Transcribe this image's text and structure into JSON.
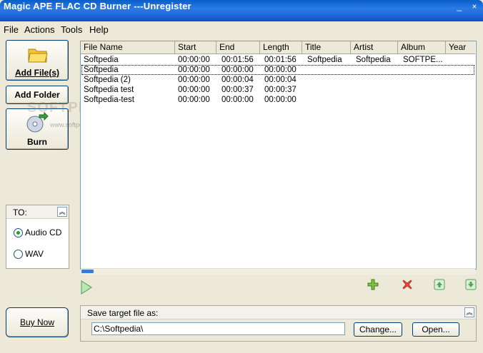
{
  "window": {
    "title": "Magic APE FLAC CD Burner ---Unregister",
    "minimize": "_",
    "close": "×"
  },
  "menu": [
    "File",
    "Actions",
    "Tools",
    "Help"
  ],
  "left": {
    "add_files": "Add File(s)",
    "add_folder": "Add Folder",
    "burn": "Burn",
    "to_panel": {
      "title": "TO:",
      "options": [
        "Audio CD",
        "WAV"
      ],
      "selected": "Audio CD"
    },
    "buy_now": "Buy Now"
  },
  "watermark": {
    "text": "SOFTPEDIA",
    "url": "www.softpedia.com"
  },
  "table": {
    "columns": [
      "File Name",
      "Start",
      "End",
      "Length",
      "Title",
      "Artist",
      "Album",
      "Year"
    ],
    "rows": [
      [
        "Softpedia",
        "00:00:00",
        "00:01:56",
        "00:01:56",
        "Softpedia",
        "Softpedia",
        "SOFTPE...",
        ""
      ],
      [
        "Softpedia",
        "00:00:00",
        "00:00:00",
        "00:00:00",
        "",
        "",
        "",
        ""
      ],
      [
        "Softpedia (2)",
        "00:00:00",
        "00:00:04",
        "00:00:04",
        "",
        "",
        "",
        ""
      ],
      [
        "Softpedia test",
        "00:00:00",
        "00:00:37",
        "00:00:37",
        "",
        "",
        "",
        ""
      ],
      [
        "Softpedia-test",
        "00:00:00",
        "00:00:00",
        "00:00:00",
        "",
        "",
        "",
        ""
      ]
    ],
    "selected_row": 1
  },
  "icons": [
    "play-icon",
    "add-icon",
    "delete-icon",
    "move-up-icon",
    "move-down-icon"
  ],
  "save_panel": {
    "title": "Save target file as:",
    "path": "C:\\Softpedia\\",
    "change": "Change...",
    "open": "Open..."
  },
  "colors": {
    "titlebar": "#1a62d4",
    "window_bg": "#ece9d8",
    "border": "#7f9db9"
  }
}
